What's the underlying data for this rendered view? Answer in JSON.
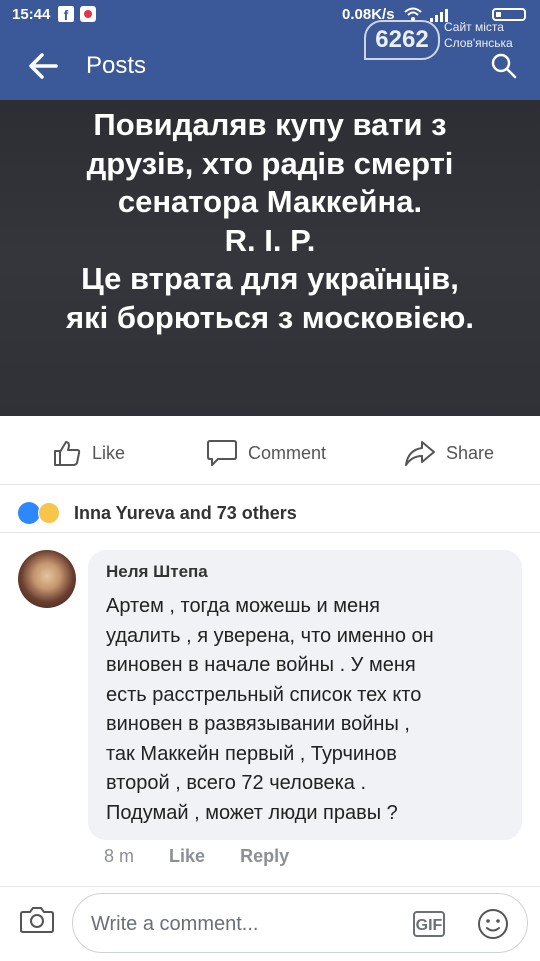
{
  "status": {
    "time": "15:44",
    "speed": "0.08K/s"
  },
  "watermark": {
    "number": "6262",
    "line1": "Сайт міста",
    "line2": "Слов'янська"
  },
  "header": {
    "title": "Posts"
  },
  "post": {
    "lines": [
      "Повидаляв купу вати з",
      "друзів, хто радів смерті",
      "сенатора Маккейна.",
      "R. I. P.",
      "Це втрата для українців,",
      "які борються з московією."
    ]
  },
  "actions": {
    "like": "Like",
    "comment": "Comment",
    "share": "Share"
  },
  "reactions": {
    "text": "Inna  Yureva and 73 others"
  },
  "comment": {
    "author": "Неля Штепа",
    "lines": [
      "Артем , тогда можешь и меня",
      "удалить , я уверена, что именно он",
      "виновен в начале войны .  У меня",
      "есть расстрельный список тех кто",
      "виновен в развязывании войны ,",
      "так Маккейн первый , Турчинов",
      "второй , всего 72 человека .",
      "Подумай , может люди правы ?"
    ],
    "time": "8 m",
    "like": "Like",
    "reply": "Reply"
  },
  "composer": {
    "placeholder": "Write a comment...",
    "gif": "GIF"
  },
  "colors": {
    "brand": "#3b5998",
    "post_bg": "#2f3136"
  }
}
